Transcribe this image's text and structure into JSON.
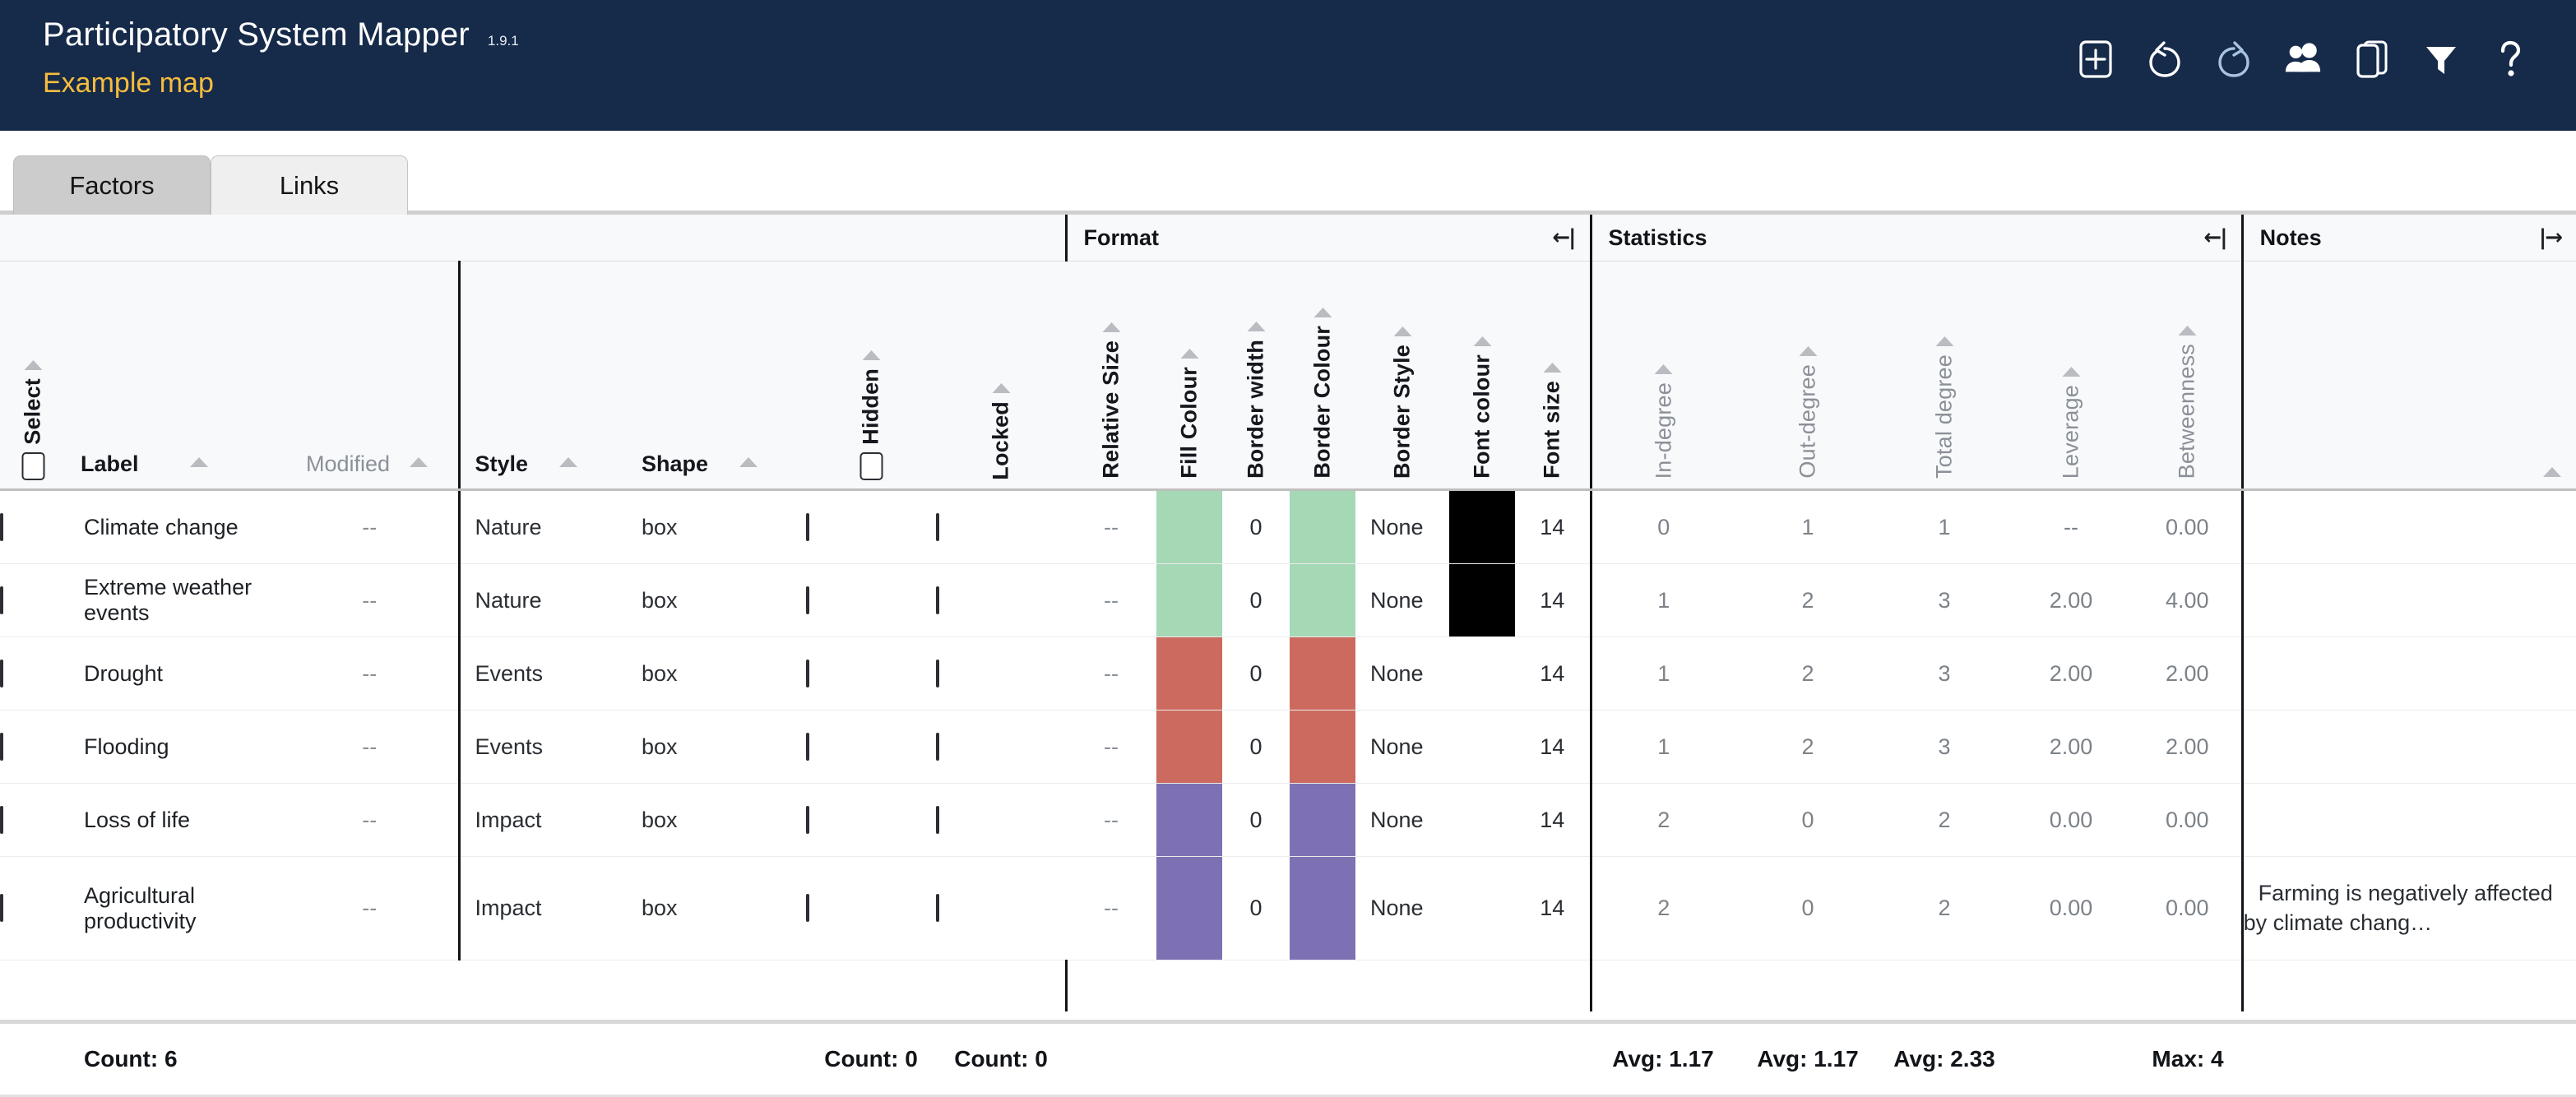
{
  "header": {
    "app_title": "Participatory System Mapper",
    "version": "1.9.1",
    "map_name": "Example map",
    "tools": [
      {
        "name": "add-icon",
        "label": "Add"
      },
      {
        "name": "undo-icon",
        "label": "Undo"
      },
      {
        "name": "redo-icon",
        "label": "Redo"
      },
      {
        "name": "people-icon",
        "label": "Collaborators"
      },
      {
        "name": "copy-icon",
        "label": "Duplicate"
      },
      {
        "name": "filter-icon",
        "label": "Filter"
      },
      {
        "name": "help-icon",
        "label": "Help"
      }
    ]
  },
  "tabs": [
    {
      "label": "Factors",
      "active": true
    },
    {
      "label": "Links",
      "active": false
    }
  ],
  "groups": {
    "base": {
      "title": "",
      "collapse_icon": ""
    },
    "format": {
      "title": "Format",
      "collapse_icon": "←|"
    },
    "statistics": {
      "title": "Statistics",
      "collapse_icon": "←|"
    },
    "notes": {
      "title": "Notes",
      "collapse_icon": "|→"
    }
  },
  "columns": {
    "select": "Select",
    "label": "Label",
    "modified": "Modified",
    "style": "Style",
    "shape": "Shape",
    "hidden": "Hidden",
    "locked": "Locked",
    "relative_size": "Relative Size",
    "fill_colour": "Fill Colour",
    "border_width": "Border width",
    "border_colour": "Border Colour",
    "border_style": "Border Style",
    "font_colour": "Font colour",
    "font_size": "Font size",
    "in_degree": "In-degree",
    "out_degree": "Out-degree",
    "total_degree": "Total degree",
    "leverage": "Leverage",
    "betweenness": "Betweenness"
  },
  "rows": [
    {
      "label": "Climate change",
      "modified": "--",
      "style": "Nature",
      "shape": "box",
      "hidden": false,
      "locked": false,
      "relative_size": "--",
      "fill_colour": "#a5d8b4",
      "border_width": "0",
      "border_colour": "#a5d8b4",
      "border_style": "None",
      "font_colour": "#000000",
      "font_size": "14",
      "in_degree": "0",
      "out_degree": "1",
      "total_degree": "1",
      "leverage": "--",
      "betweenness": "0.00",
      "notes": ""
    },
    {
      "label": "Extreme weather events",
      "modified": "--",
      "style": "Nature",
      "shape": "box",
      "hidden": false,
      "locked": false,
      "relative_size": "--",
      "fill_colour": "#a5d8b4",
      "border_width": "0",
      "border_colour": "#a5d8b4",
      "border_style": "None",
      "font_colour": "#000000",
      "font_size": "14",
      "in_degree": "1",
      "out_degree": "2",
      "total_degree": "3",
      "leverage": "2.00",
      "betweenness": "4.00",
      "notes": ""
    },
    {
      "label": "Drought",
      "modified": "--",
      "style": "Events",
      "shape": "box",
      "hidden": false,
      "locked": false,
      "relative_size": "--",
      "fill_colour": "#cc6a5f",
      "border_width": "0",
      "border_colour": "#cc6a5f",
      "border_style": "None",
      "font_colour": "",
      "font_size": "14",
      "in_degree": "1",
      "out_degree": "2",
      "total_degree": "3",
      "leverage": "2.00",
      "betweenness": "2.00",
      "notes": ""
    },
    {
      "label": "Flooding",
      "modified": "--",
      "style": "Events",
      "shape": "box",
      "hidden": false,
      "locked": false,
      "relative_size": "--",
      "fill_colour": "#cc6a5f",
      "border_width": "0",
      "border_colour": "#cc6a5f",
      "border_style": "None",
      "font_colour": "",
      "font_size": "14",
      "in_degree": "1",
      "out_degree": "2",
      "total_degree": "3",
      "leverage": "2.00",
      "betweenness": "2.00",
      "notes": ""
    },
    {
      "label": "Loss of life",
      "modified": "--",
      "style": "Impact",
      "shape": "box",
      "hidden": false,
      "locked": false,
      "relative_size": "--",
      "fill_colour": "#7e71b3",
      "border_width": "0",
      "border_colour": "#7e71b3",
      "border_style": "None",
      "font_colour": "",
      "font_size": "14",
      "in_degree": "2",
      "out_degree": "0",
      "total_degree": "2",
      "leverage": "0.00",
      "betweenness": "0.00",
      "notes": ""
    },
    {
      "label": "Agricultural productivity",
      "modified": "--",
      "style": "Impact",
      "shape": "box",
      "hidden": false,
      "locked": false,
      "relative_size": "--",
      "fill_colour": "#7e71b3",
      "border_width": "0",
      "border_colour": "#7e71b3",
      "border_style": "None",
      "font_colour": "",
      "font_size": "14",
      "in_degree": "2",
      "out_degree": "0",
      "total_degree": "2",
      "leverage": "0.00",
      "betweenness": "0.00",
      "notes": "Farming is negatively affected by climate chang…"
    }
  ],
  "footer": {
    "label_count": "Count: 6",
    "hidden_count": "Count: 0",
    "locked_count": "Count: 0",
    "in_degree_avg": "Avg: 1.17",
    "out_degree_avg": "Avg: 1.17",
    "total_degree_avg": "Avg: 2.33",
    "betweenness_max": "Max: 4"
  }
}
